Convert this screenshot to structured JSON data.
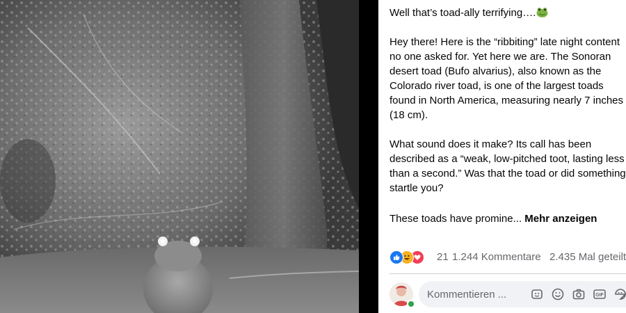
{
  "post": {
    "title": "Well that’s toad-ally terrifying….",
    "title_emoji": "frog-face-emoji",
    "paragraph1": "Hey there! Here is the “ribbiting” late night content no one asked for. Yet here we are. The Sonoran desert toad (Bufo alvarius), also known as the Colorado river toad, is one of the largest toads found in North America, measuring nearly 7 inches (18 cm).",
    "paragraph2": "What sound does it make? Its call has been described as a “weak, low-pitched toot, lasting less than a second.” Was that the toad or did something startle you?",
    "paragraph3_truncated": "These toads have promine... ",
    "see_more_label": "Mehr anzeigen"
  },
  "reactions": {
    "icons": [
      "like-icon",
      "haha-icon",
      "love-icon"
    ],
    "count": "21",
    "comments": "1.244 Kommentare",
    "shares": "2.435 Mal geteilt"
  },
  "comment_box": {
    "placeholder": "Kommentieren ...",
    "icons": [
      "sticker-icon",
      "emoji-icon",
      "camera-icon",
      "gif-icon",
      "sticker-face-icon"
    ],
    "gif_label": "GIF"
  },
  "photo": {
    "description_icon": "night-vision-toad-photo"
  },
  "colors": {
    "text": "#050505",
    "secondary": "#65676b",
    "like": "#1877f2",
    "haha": "#f7b125",
    "love": "#f33e58",
    "online": "#31a24c"
  }
}
